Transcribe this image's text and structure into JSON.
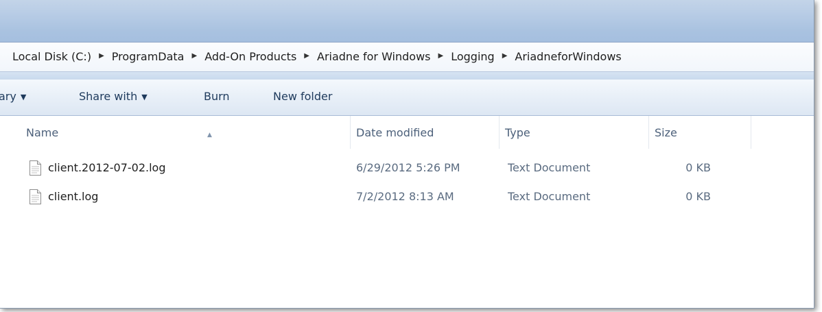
{
  "breadcrumb": [
    "Local Disk (C:)",
    "ProgramData",
    "Add-On Products",
    "Ariadne for Windows",
    "Logging",
    "AriadneforWindows"
  ],
  "toolbar": {
    "library_label": "ary",
    "share_label": "Share with",
    "burn_label": "Burn",
    "new_folder_label": "New folder"
  },
  "columns": {
    "name": "Name",
    "date": "Date modified",
    "type": "Type",
    "size": "Size"
  },
  "files": [
    {
      "name": "client.2012-07-02.log",
      "date": "6/29/2012 5:26 PM",
      "type": "Text Document",
      "size": "0 KB",
      "icon": "text-file-icon"
    },
    {
      "name": "client.log",
      "date": "7/2/2012 8:13 AM",
      "type": "Text Document",
      "size": "0 KB",
      "icon": "text-file-icon"
    }
  ],
  "colors": {
    "title_strip": "#b9cde6",
    "toolbar_text": "#1e3a5c",
    "header_text": "#4c607a"
  }
}
